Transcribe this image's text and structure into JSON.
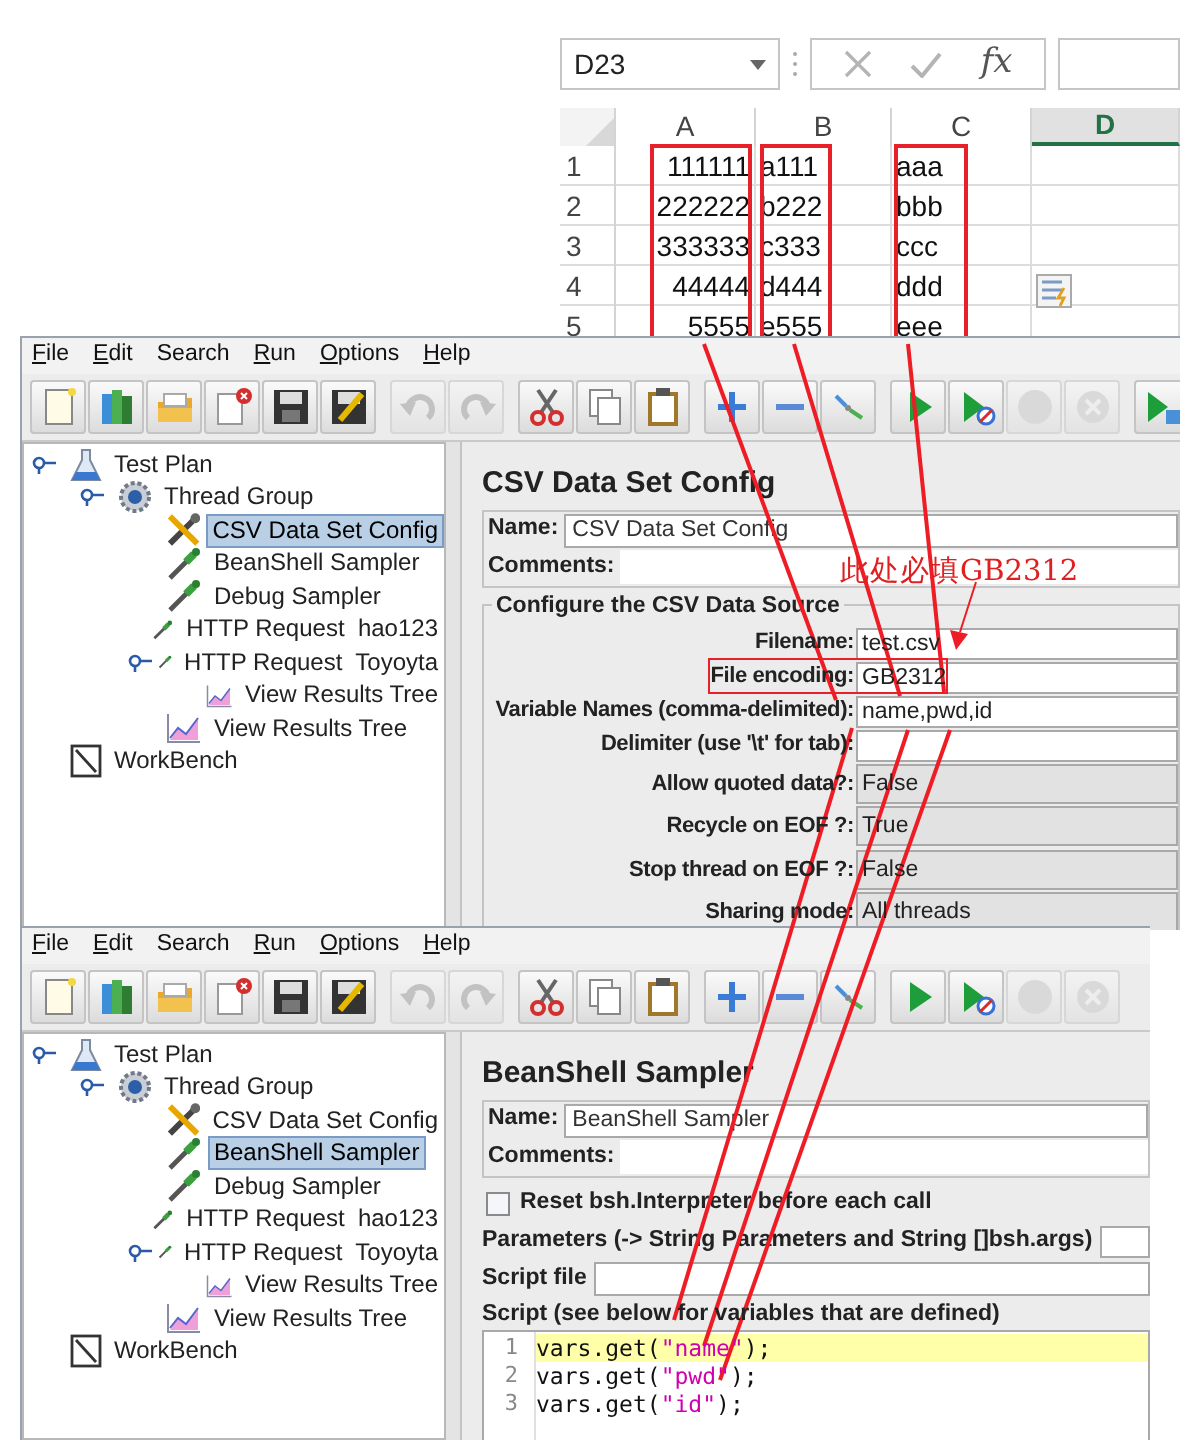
{
  "spreadsheet": {
    "name_box": "D23",
    "function_label": "fx",
    "columns": [
      {
        "label": "A",
        "selected": false,
        "boxed": true
      },
      {
        "label": "B",
        "selected": false,
        "boxed": true
      },
      {
        "label": "C",
        "selected": false,
        "boxed": true
      },
      {
        "label": "D",
        "selected": true,
        "boxed": false
      }
    ],
    "rows": [
      {
        "number": "1",
        "cells": [
          "111111",
          "a111",
          "aaa"
        ]
      },
      {
        "number": "2",
        "cells": [
          "222222",
          "b222",
          "bbb"
        ]
      },
      {
        "number": "3",
        "cells": [
          "333333",
          "c333",
          "ccc"
        ]
      },
      {
        "number": "4",
        "cells": [
          "44444",
          "d444",
          "ddd"
        ]
      },
      {
        "number": "5",
        "cells": [
          "5555",
          "e555",
          "eee"
        ]
      }
    ]
  },
  "windows": [
    {
      "menu": [
        {
          "label": "File",
          "mnemonic": true
        },
        {
          "label": "Edit",
          "mnemonic": true
        },
        {
          "label": "Search",
          "mnemonic": false
        },
        {
          "label": "Run",
          "mnemonic": true
        },
        {
          "label": "Options",
          "mnemonic": true
        },
        {
          "label": "Help",
          "mnemonic": true
        }
      ],
      "toolbar": [
        [
          {
            "kind": "new",
            "disabled": false
          },
          {
            "kind": "templates",
            "disabled": false
          },
          {
            "kind": "open",
            "disabled": false
          },
          {
            "kind": "close",
            "disabled": false
          },
          {
            "kind": "save",
            "disabled": false
          },
          {
            "kind": "save-as",
            "disabled": false
          }
        ],
        [
          {
            "kind": "undo",
            "disabled": true
          },
          {
            "kind": "redo",
            "disabled": true
          }
        ],
        [
          {
            "kind": "cut",
            "disabled": false
          },
          {
            "kind": "copy",
            "disabled": false
          },
          {
            "kind": "paste",
            "disabled": false
          }
        ],
        [
          {
            "kind": "expand",
            "disabled": false
          },
          {
            "kind": "collapse",
            "disabled": false
          },
          {
            "kind": "toggle",
            "disabled": false
          }
        ],
        [
          {
            "kind": "start",
            "disabled": false
          },
          {
            "kind": "start-no-pause",
            "disabled": false
          },
          {
            "kind": "stop",
            "disabled": true
          },
          {
            "kind": "shutdown",
            "disabled": true
          }
        ],
        [
          {
            "kind": "remote-start",
            "disabled": false
          }
        ]
      ],
      "tree": [
        {
          "label": "Test Plan",
          "kind": "plan",
          "expanded": true,
          "selected": false,
          "children": [
            {
              "label": "Thread Group",
              "kind": "thread",
              "expanded": true,
              "selected": false,
              "children": [
                {
                  "label": "CSV Data Set Config",
                  "kind": "config",
                  "expanded": false,
                  "selected": true
                },
                {
                  "label": "BeanShell Sampler",
                  "kind": "sampler",
                  "expanded": false,
                  "selected": false
                },
                {
                  "label": "Debug Sampler",
                  "kind": "sampler",
                  "expanded": false,
                  "selected": false
                },
                {
                  "label": "HTTP Request  hao123",
                  "kind": "sampler",
                  "expanded": false,
                  "selected": false
                },
                {
                  "label": "HTTP Request  Toyoyta",
                  "kind": "sampler",
                  "expanded": true,
                  "selected": false,
                  "children": [
                    {
                      "label": "View Results Tree",
                      "kind": "listener",
                      "expanded": false,
                      "selected": false
                    }
                  ]
                },
                {
                  "label": "View Results Tree",
                  "kind": "listener",
                  "expanded": false,
                  "selected": false
                }
              ]
            }
          ]
        },
        {
          "label": "WorkBench",
          "kind": "workbench",
          "expanded": false,
          "selected": false
        }
      ],
      "panel": {
        "kind": "csv",
        "title": "CSV Data Set Config",
        "name_label": "Name:",
        "name": "CSV Data Set Config",
        "comments_label": "Comments:",
        "group_title": "Configure the CSV Data Source",
        "note": "此处必填GB2312",
        "fields": [
          {
            "label": "Filename:",
            "value": "test.csv",
            "kind": "text",
            "boxed": false
          },
          {
            "label": "File encoding:",
            "value": "GB2312",
            "kind": "text",
            "boxed": true
          },
          {
            "label": "Variable Names (comma-delimited):",
            "value": "name,pwd,id",
            "kind": "text",
            "boxed": false
          },
          {
            "label": "Delimiter (use '\\t' for tab):",
            "kind": "text",
            "boxed": false
          },
          {
            "label": "Allow quoted data?:",
            "value": "False",
            "kind": "select",
            "boxed": false
          },
          {
            "label": "Recycle on EOF ?:",
            "value": "True",
            "kind": "select",
            "boxed": false
          },
          {
            "label": "Stop thread on EOF ?:",
            "value": "False",
            "kind": "select",
            "boxed": false
          },
          {
            "label": "Sharing mode:",
            "value": "All threads",
            "kind": "select",
            "boxed": false
          }
        ]
      }
    },
    {
      "menu": [
        {
          "label": "File",
          "mnemonic": true
        },
        {
          "label": "Edit",
          "mnemonic": true
        },
        {
          "label": "Search",
          "mnemonic": false
        },
        {
          "label": "Run",
          "mnemonic": true
        },
        {
          "label": "Options",
          "mnemonic": true
        },
        {
          "label": "Help",
          "mnemonic": true
        }
      ],
      "toolbar": [
        [
          {
            "kind": "new",
            "disabled": false
          },
          {
            "kind": "templates",
            "disabled": false
          },
          {
            "kind": "open",
            "disabled": false
          },
          {
            "kind": "close",
            "disabled": false
          },
          {
            "kind": "save",
            "disabled": false
          },
          {
            "kind": "save-as",
            "disabled": false
          }
        ],
        [
          {
            "kind": "undo",
            "disabled": true
          },
          {
            "kind": "redo",
            "disabled": true
          }
        ],
        [
          {
            "kind": "cut",
            "disabled": false
          },
          {
            "kind": "copy",
            "disabled": false
          },
          {
            "kind": "paste",
            "disabled": false
          }
        ],
        [
          {
            "kind": "expand",
            "disabled": false
          },
          {
            "kind": "collapse",
            "disabled": false
          },
          {
            "kind": "toggle",
            "disabled": false
          }
        ],
        [
          {
            "kind": "start",
            "disabled": false
          },
          {
            "kind": "start-no-pause",
            "disabled": false
          },
          {
            "kind": "stop",
            "disabled": true
          },
          {
            "kind": "shutdown",
            "disabled": true
          }
        ]
      ],
      "tree": [
        {
          "label": "Test Plan",
          "kind": "plan",
          "expanded": true,
          "selected": false,
          "children": [
            {
              "label": "Thread Group",
              "kind": "thread",
              "expanded": true,
              "selected": false,
              "children": [
                {
                  "label": "CSV Data Set Config",
                  "kind": "config",
                  "expanded": false,
                  "selected": false
                },
                {
                  "label": "BeanShell Sampler",
                  "kind": "sampler",
                  "expanded": false,
                  "selected": true
                },
                {
                  "label": "Debug Sampler",
                  "kind": "sampler",
                  "expanded": false,
                  "selected": false
                },
                {
                  "label": "HTTP Request  hao123",
                  "kind": "sampler",
                  "expanded": false,
                  "selected": false
                },
                {
                  "label": "HTTP Request  Toyoyta",
                  "kind": "sampler",
                  "expanded": true,
                  "selected": false,
                  "children": [
                    {
                      "label": "View Results Tree",
                      "kind": "listener",
                      "expanded": false,
                      "selected": false
                    }
                  ]
                },
                {
                  "label": "View Results Tree",
                  "kind": "listener",
                  "expanded": false,
                  "selected": false
                }
              ]
            }
          ]
        },
        {
          "label": "WorkBench",
          "kind": "workbench",
          "expanded": false,
          "selected": false
        }
      ],
      "panel": {
        "kind": "beanshell",
        "title": "BeanShell Sampler",
        "name_label": "Name:",
        "name": "BeanShell Sampler",
        "comments_label": "Comments:",
        "checkbox": {
          "label": "Reset bsh.Interpreter before each call",
          "checked": false
        },
        "params_label": "Parameters (-> String Parameters and String []bsh.args)",
        "script_file_label": "Script file",
        "script_label": "Script (see below for variables that are defined)",
        "code": [
          {
            "number": "1",
            "highlighted": true,
            "parts": [
              {
                "text": "vars.get(",
                "kind": "plain"
              },
              {
                "text": "\"name\"",
                "kind": "string"
              },
              {
                "text": ");",
                "kind": "plain"
              }
            ]
          },
          {
            "number": "2",
            "highlighted": false,
            "parts": [
              {
                "text": "vars.get(",
                "kind": "plain"
              },
              {
                "text": "\"pwd\"",
                "kind": "string"
              },
              {
                "text": ");",
                "kind": "plain"
              }
            ]
          },
          {
            "number": "3",
            "highlighted": false,
            "parts": [
              {
                "text": "vars.get(",
                "kind": "plain"
              },
              {
                "text": "\"id\"",
                "kind": "string"
              },
              {
                "text": ");",
                "kind": "plain"
              }
            ]
          }
        ]
      }
    }
  ]
}
